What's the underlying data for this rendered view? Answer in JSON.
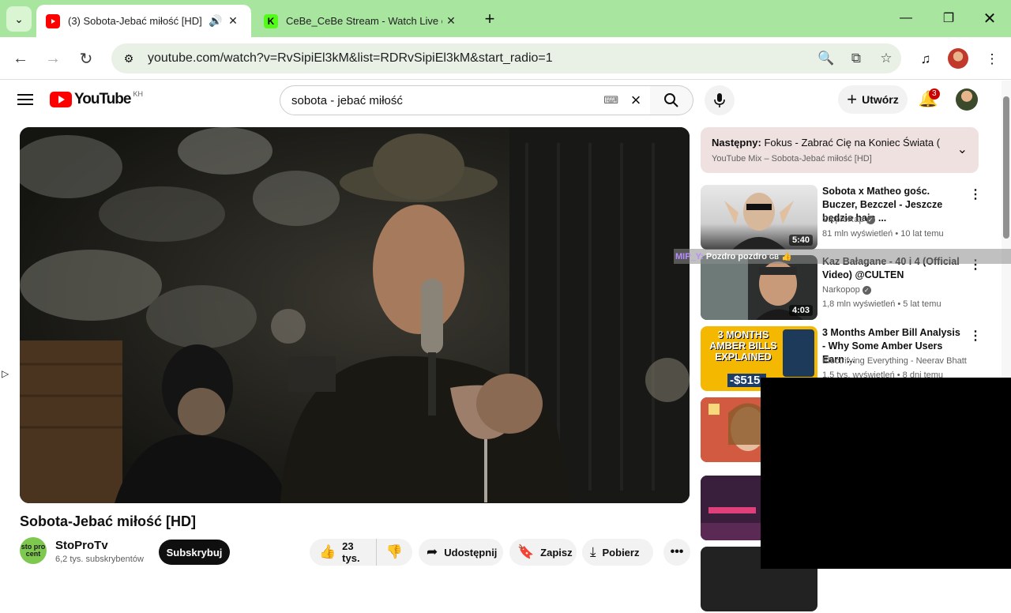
{
  "browser": {
    "tabs": [
      {
        "title": "(3) Sobota-Jebać miłość [HD]",
        "active": true,
        "icon": "youtube-favicon"
      },
      {
        "title": "CeBe_CeBe Stream - Watch Live on",
        "active": false,
        "icon": "kick-favicon"
      }
    ],
    "url": "youtube.com/watch?v=RvSipiEl3kM&list=RDRvSipiEl3kM&start_radio=1"
  },
  "youtube": {
    "logo_text": "YouTube",
    "country_code": "KH",
    "search_query": "sobota - jebać miłość",
    "create_label": "Utwórz",
    "notification_count": "3"
  },
  "video": {
    "title": "Sobota-Jebać miłość [HD]",
    "channel": "StoProTv",
    "subscribers": "6,2 tys. subskrybentów",
    "subscribe_label": "Subskrybuj",
    "likes": "23 tys.",
    "share_label": "Udostępnij",
    "save_label": "Zapisz",
    "download_label": "Pobierz",
    "channel_avatar_text": "sto pro cent"
  },
  "up_next": {
    "prefix": "Następny:",
    "title": "Fokus - Zabrać Cię na Koniec Świata (Br...",
    "playlist": "YouTube Mix – Sobota-Jebać miłość [HD]"
  },
  "recommendations": [
    {
      "title": "Sobota x Matheo gośc. Buczer, Bezczel - Jeszcze będzie hajc ...",
      "channel": "StoproRap",
      "verified": true,
      "meta": "81 mln wyświetleń • 10 lat temu",
      "duration": "5:40"
    },
    {
      "title": "Kaz Bałagane - 40 i 4 (Official Video) @CULTEN",
      "channel": "Narkopop",
      "verified": true,
      "meta": "1,8 mln wyświetleń • 5 lat temu",
      "duration": "4:03"
    },
    {
      "title": "3 Months Amber Bill Analysis - Why Some Amber Users Earn ...",
      "channel": "Electrifying Everything - Neerav Bhatt",
      "verified": false,
      "meta": "1,5 tys. wyświetleń • 8 dni temu",
      "thumb_text": "3 MONTHS AMBER BILLS EXPLAINED",
      "thumb_price": "-$515."
    }
  ],
  "chat_overlay": {
    "user": "MIP_Y:",
    "message": "Pozdro pozdro",
    "badge": "GB"
  }
}
